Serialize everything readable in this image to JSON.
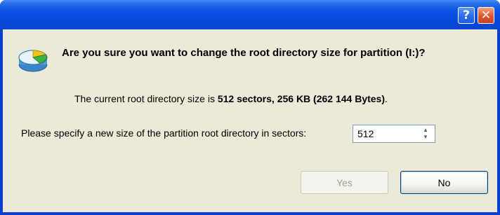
{
  "titlebar": {
    "help_label": "?",
    "close_label": "✕"
  },
  "dialog": {
    "icon": "disk-partition-pie-icon",
    "question": "Are you sure you want to change the root directory size for partition (I:)?",
    "info_prefix": "The current root directory size is ",
    "info_value": "512 sectors, 256 KB (262 144 Bytes)",
    "info_suffix": ".",
    "prompt": "Please specify a new size of the partition root directory in sectors:",
    "size_value": "512",
    "yes_label": "Yes",
    "no_label": "No"
  },
  "colors": {
    "titlebar": "#0548d8",
    "client": "#ece9d8",
    "close_button": "#e2582f"
  }
}
